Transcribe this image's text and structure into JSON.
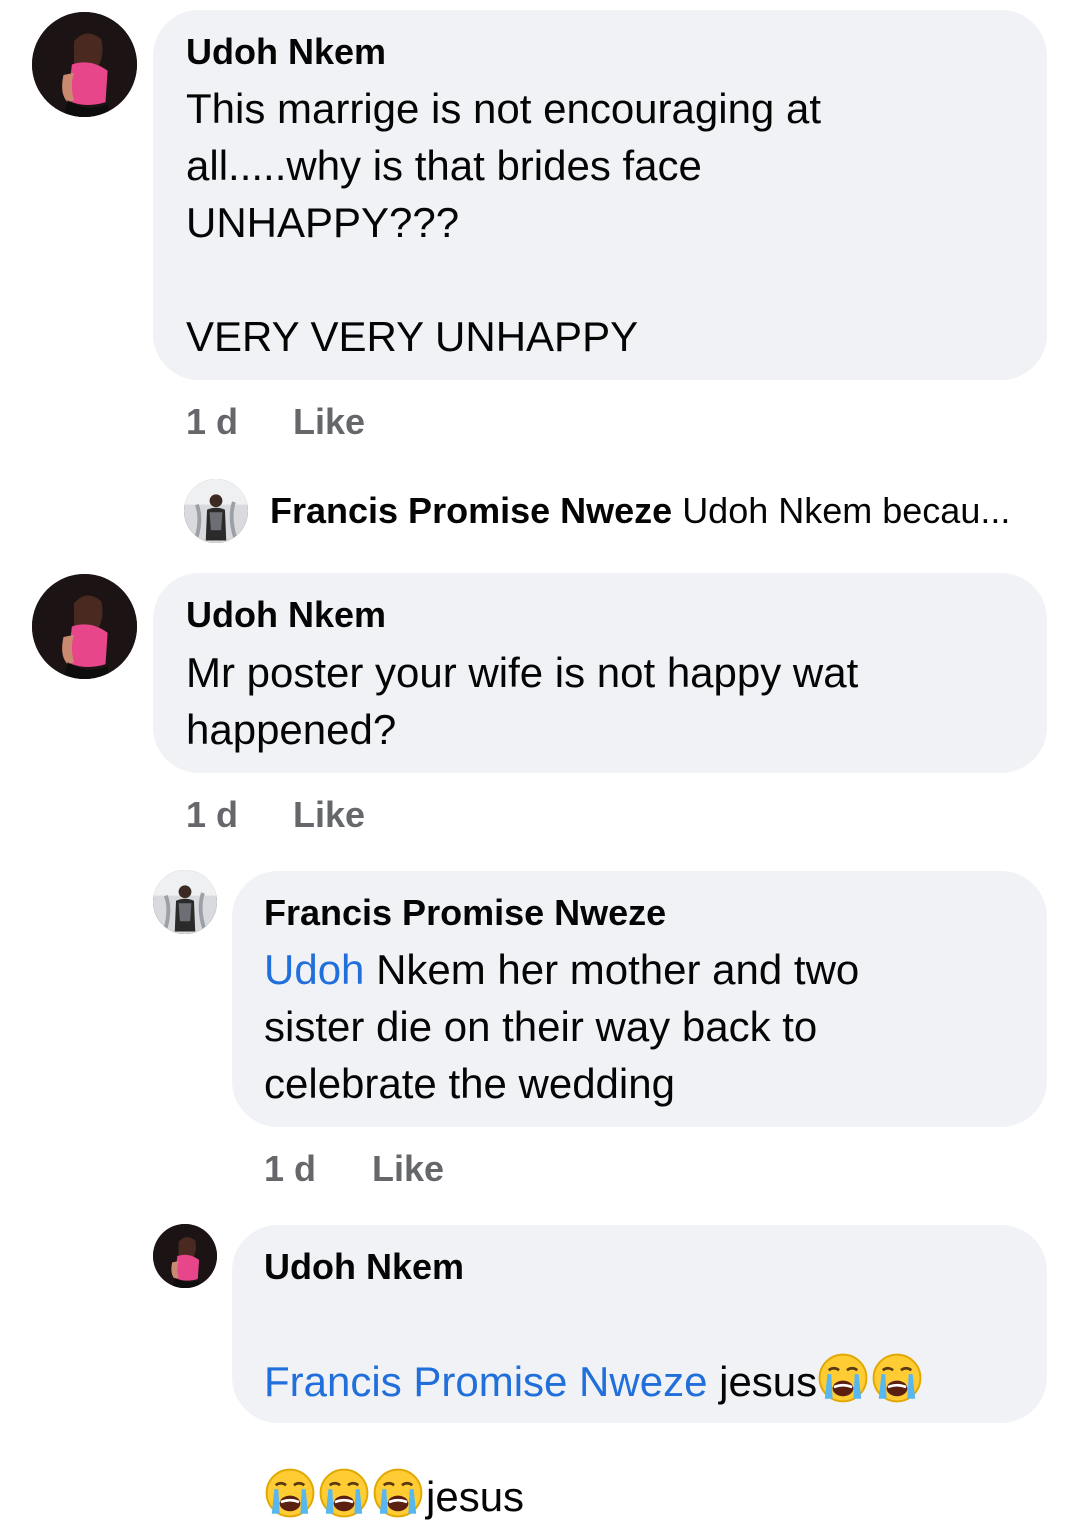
{
  "comments": [
    {
      "author": "Udoh Nkem",
      "text": "This marrige is not encouraging at\nall.....why is that brides face\nUNHAPPY???\n\nVERY VERY UNHAPPY",
      "time": "1 d",
      "like_label": "Like"
    },
    {
      "author": "Udoh Nkem",
      "text": "Mr poster your wife is not happy wat\nhappened?",
      "time": "1 d",
      "like_label": "Like"
    }
  ],
  "collapsed_reply": {
    "author": "Francis Promise Nweze",
    "preview": "Udoh Nkem becau..."
  },
  "reply_1": {
    "author": "Francis Promise Nweze",
    "mention": "Udoh",
    "text": " Nkem her mother and two\nsister die on their way back to\ncelebrate the wedding",
    "time": "1 d",
    "like_label": "Like"
  },
  "reply_2": {
    "author": "Udoh Nkem",
    "mention": "Francis Promise Nweze",
    "word1": " jesus",
    "word2": "jesus",
    "emoji": "loudly-crying-face"
  },
  "colors": {
    "bubble": "#f0f2f5",
    "link": "#216fdb",
    "meta": "#65676b",
    "text": "#050505"
  }
}
